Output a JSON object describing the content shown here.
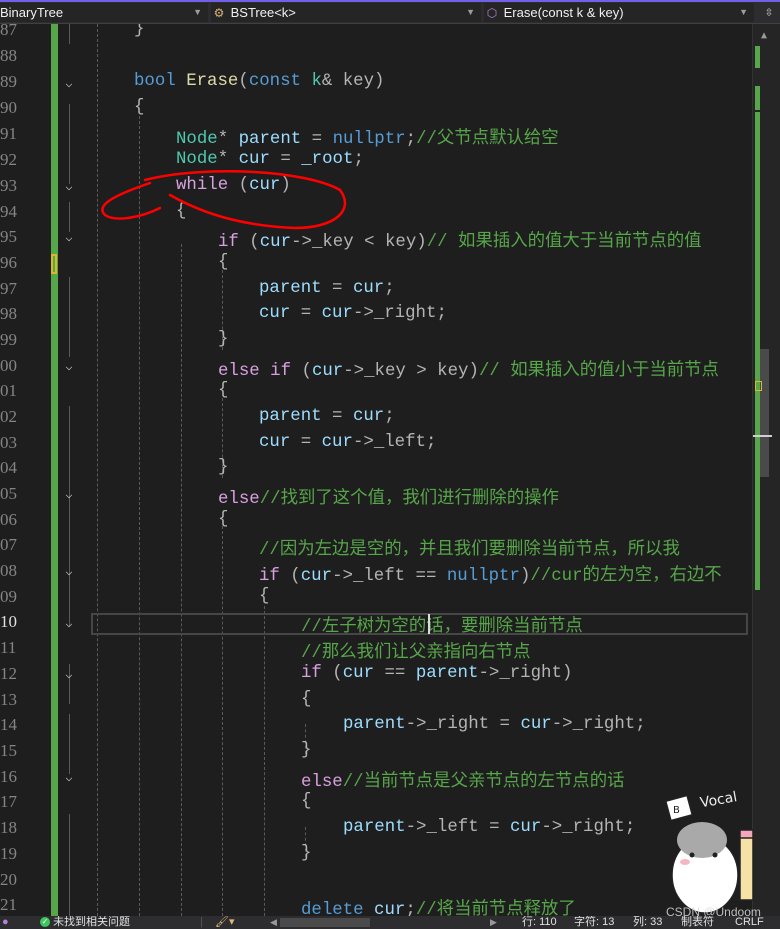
{
  "navbar": {
    "project": "BinaryTree",
    "class_scope": "BSTree<k>",
    "member_scope": "Erase(const k & key)",
    "class_icon": "class-icon",
    "member_icon": "method-icon"
  },
  "editor": {
    "current_line": 110,
    "lines": [
      {
        "n": "87"
      },
      {
        "n": "88"
      },
      {
        "n": "89"
      },
      {
        "n": "90"
      },
      {
        "n": "91"
      },
      {
        "n": "92"
      },
      {
        "n": "93"
      },
      {
        "n": "94"
      },
      {
        "n": "95"
      },
      {
        "n": "96"
      },
      {
        "n": "97"
      },
      {
        "n": "98"
      },
      {
        "n": "99"
      },
      {
        "n": "100"
      },
      {
        "n": "101"
      },
      {
        "n": "102"
      },
      {
        "n": "103"
      },
      {
        "n": "104"
      },
      {
        "n": "105"
      },
      {
        "n": "106"
      },
      {
        "n": "107"
      },
      {
        "n": "108"
      },
      {
        "n": "109"
      },
      {
        "n": "110"
      },
      {
        "n": "111"
      },
      {
        "n": "112"
      },
      {
        "n": "113"
      },
      {
        "n": "114"
      },
      {
        "n": "115"
      },
      {
        "n": "116"
      },
      {
        "n": "117"
      },
      {
        "n": "118"
      },
      {
        "n": "119"
      },
      {
        "n": "120"
      },
      {
        "n": "121"
      }
    ],
    "code": {
      "l87": "}",
      "l89_bool": "bool",
      "l89_fn": "Erase",
      "l89_open": "(",
      "l89_const": "const",
      "l89_k": "k",
      "l89_rest": "& key)",
      "l90": "{",
      "l91_type": "Node",
      "l91_star": "*",
      "l91_var": " parent",
      "l91_eq": " = ",
      "l91_null": "nullptr",
      "l91_semi": ";",
      "l91_cm": "//父节点默认给空",
      "l92_type": "Node",
      "l92_star": "*",
      "l92_var": " cur",
      "l92_eq": " = ",
      "l92_root": "_root",
      "l92_semi": ";",
      "l93_kw": "while",
      "l93_p1": " (",
      "l93_var": "cur",
      "l93_p2": ")",
      "l94": "{",
      "l95_kw": "if",
      "l95_p": " (",
      "l95_var": "cur",
      "l95_op": "->",
      "l95_mem": "_key",
      "l95_cmp": " < key)",
      "l95_cm": "// 如果插入的值大于当前节点的值",
      "l96": "{",
      "l97_a": "parent",
      "l97_b": " = ",
      "l97_c": "cur",
      "l97_d": ";",
      "l98_a": "cur",
      "l98_b": " = ",
      "l98_c": "cur",
      "l98_op": "->",
      "l98_mem": "_right",
      "l98_d": ";",
      "l99": "}",
      "l100_kw": "else if",
      "l100_p": " (",
      "l100_var": "cur",
      "l100_op": "->",
      "l100_mem": "_key",
      "l100_cmp": " > key)",
      "l100_cm": "// 如果插入的值小于当前节点",
      "l101": "{",
      "l102_a": "parent",
      "l102_b": " = ",
      "l102_c": "cur",
      "l102_d": ";",
      "l103_a": "cur",
      "l103_b": " = ",
      "l103_c": "cur",
      "l103_op": "->",
      "l103_mem": "_left",
      "l103_d": ";",
      "l104": "}",
      "l105_kw": "else",
      "l105_cm": "//找到了这个值，我们进行删除的操作",
      "l106": "{",
      "l107_cm": "//因为左边是空的，并且我们要删除当前节点，所以我",
      "l108_kw": "if",
      "l108_p": " (",
      "l108_var": "cur",
      "l108_op": "->",
      "l108_mem": "_left",
      "l108_eq": " == ",
      "l108_null": "nullptr",
      "l108_p2": ")",
      "l108_cm": "//cur的左为空，右边不",
      "l109": "{",
      "l110_cm": "//左子树为空的话，要删除当前节点",
      "l111_cm": "//那么我们让父亲指向右节点",
      "l112_kw": "if",
      "l112_p": " (",
      "l112_var": "cur",
      "l112_eq": " == ",
      "l112_var2": "parent",
      "l112_op": "->",
      "l112_mem": "_right",
      "l112_p2": ")",
      "l113": "{",
      "l114_a": "parent",
      "l114_op": "->",
      "l114_mem": "_right",
      "l114_eq": " = ",
      "l114_c": "cur",
      "l114_op2": "->",
      "l114_mem2": "_right",
      "l114_d": ";",
      "l115": "}",
      "l116_kw": "else",
      "l116_cm": "//当前节点是父亲节点的左节点的话",
      "l117": "{",
      "l118_a": "parent",
      "l118_op": "->",
      "l118_mem": "_left",
      "l118_eq": " = ",
      "l118_c": "cur",
      "l118_op2": "->",
      "l118_mem2": "_right",
      "l118_d": ";",
      "l119": "}",
      "l121_kw": "delete",
      "l121_var": " cur",
      "l121_semi": ";",
      "l121_cm": "//将当前节点释放了"
    }
  },
  "statusbar": {
    "issues": "未找到相关问题",
    "line": "行: 110",
    "char": "字符: 13",
    "col": "列: 33",
    "indent": "制表符",
    "eol": "CRLF"
  },
  "overlay": {
    "sticker_text": "Vocal",
    "sticker_badge": "B",
    "watermark": "CSDN @Undoom"
  },
  "colors": {
    "accent": "#7160e8",
    "change_bar": "#57a64a",
    "annotation": "#ff0000"
  }
}
